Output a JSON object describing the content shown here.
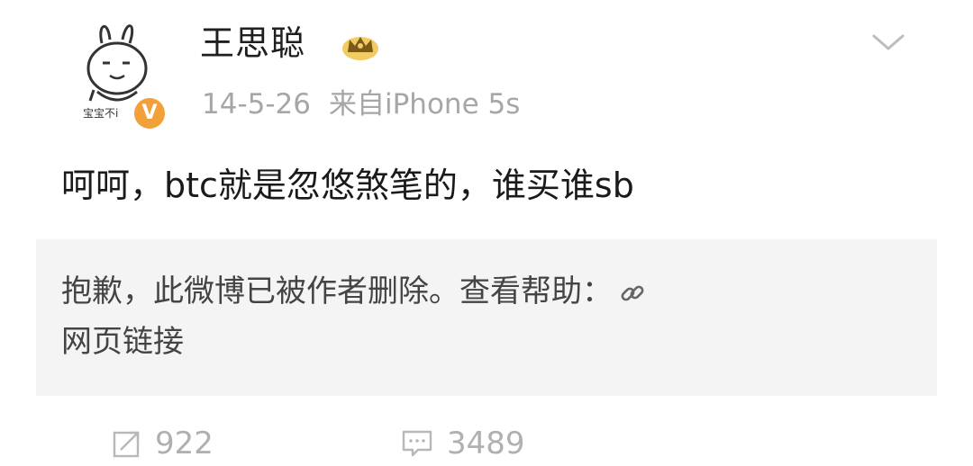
{
  "post": {
    "username": "王思聪",
    "date": "14-5-26",
    "source": "来自iPhone 5s",
    "text": "呵呵，btc就是忽悠煞笔的，谁买谁sb",
    "deleted_notice": "抱歉，此微博已被作者删除。查看帮助：",
    "deleted_link_text": "网页链接",
    "avatar_caption": "宝宝不i",
    "verified_mark": "V",
    "repost_count": "922",
    "comment_count": "3489"
  },
  "icons": {
    "crown": "crown-icon",
    "chevron": "chevron-down-icon",
    "link": "link-icon",
    "repost": "repost-icon",
    "comment": "comment-icon"
  },
  "colors": {
    "verified": "#f2a03a",
    "crown": "#e2b53a",
    "meta_gray": "#a6a6a6",
    "deleted_bg": "#f4f4f4"
  }
}
